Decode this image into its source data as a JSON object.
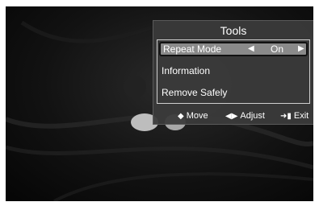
{
  "tools": {
    "title": "Tools",
    "items": [
      {
        "label": "Repeat Mode",
        "value": "On",
        "left_arrow": "◀",
        "right_arrow": "▶",
        "selected": true
      },
      {
        "label": "Information"
      },
      {
        "label": "Remove Safely"
      }
    ]
  },
  "footer": {
    "move": {
      "icon": "up-down-arrow-icon",
      "glyph": "◆",
      "label": "Move"
    },
    "adjust": {
      "icon": "left-right-arrow-icon",
      "glyph": "◀▶",
      "label": "Adjust"
    },
    "exit": {
      "icon": "exit-icon",
      "glyph": "➜▮",
      "label": "Exit"
    }
  },
  "colors": {
    "panel": "#3a3a3a",
    "highlight": "#8a8a8a",
    "text": "#ffffff",
    "background": "#0e0e0e"
  }
}
